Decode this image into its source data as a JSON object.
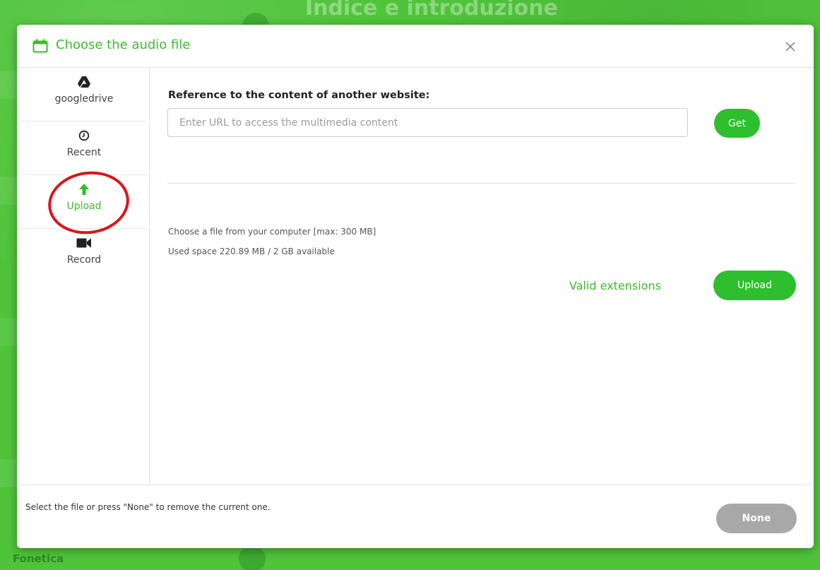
{
  "background": {
    "page_title": "Indice e introduzione",
    "footer_label": "Fonetica"
  },
  "modal": {
    "title": "Choose the audio file",
    "title_icon": "calendar-icon",
    "close_icon": "close-icon"
  },
  "sidebar": {
    "items": [
      {
        "label": "googledrive",
        "icon": "google-drive-icon",
        "active": false
      },
      {
        "label": "Recent",
        "icon": "clock-icon",
        "active": false
      },
      {
        "label": "Upload",
        "icon": "arrow-up-icon",
        "active": true
      },
      {
        "label": "Record",
        "icon": "video-camera-icon",
        "active": false
      }
    ]
  },
  "reference": {
    "label": "Reference to the content of another website:",
    "url_placeholder": "Enter URL to access the multimedia content",
    "url_value": "",
    "get_label": "Get"
  },
  "upload": {
    "choose_text": "Choose a file from your computer [max: 300 MB]",
    "used_space_text": "Used space 220.89 MB / 2 GB available",
    "valid_extensions_label": "Valid extensions",
    "upload_label": "Upload"
  },
  "footer": {
    "hint": "Select the file or press \"None\" to remove the current one.",
    "none_label": "None"
  },
  "colors": {
    "accent": "#3cbc2c",
    "button_green": "#2dbf2d",
    "button_disabled": "#a8a8a8",
    "annotation_red": "#e0131b",
    "background_green": "#4fc43a"
  }
}
